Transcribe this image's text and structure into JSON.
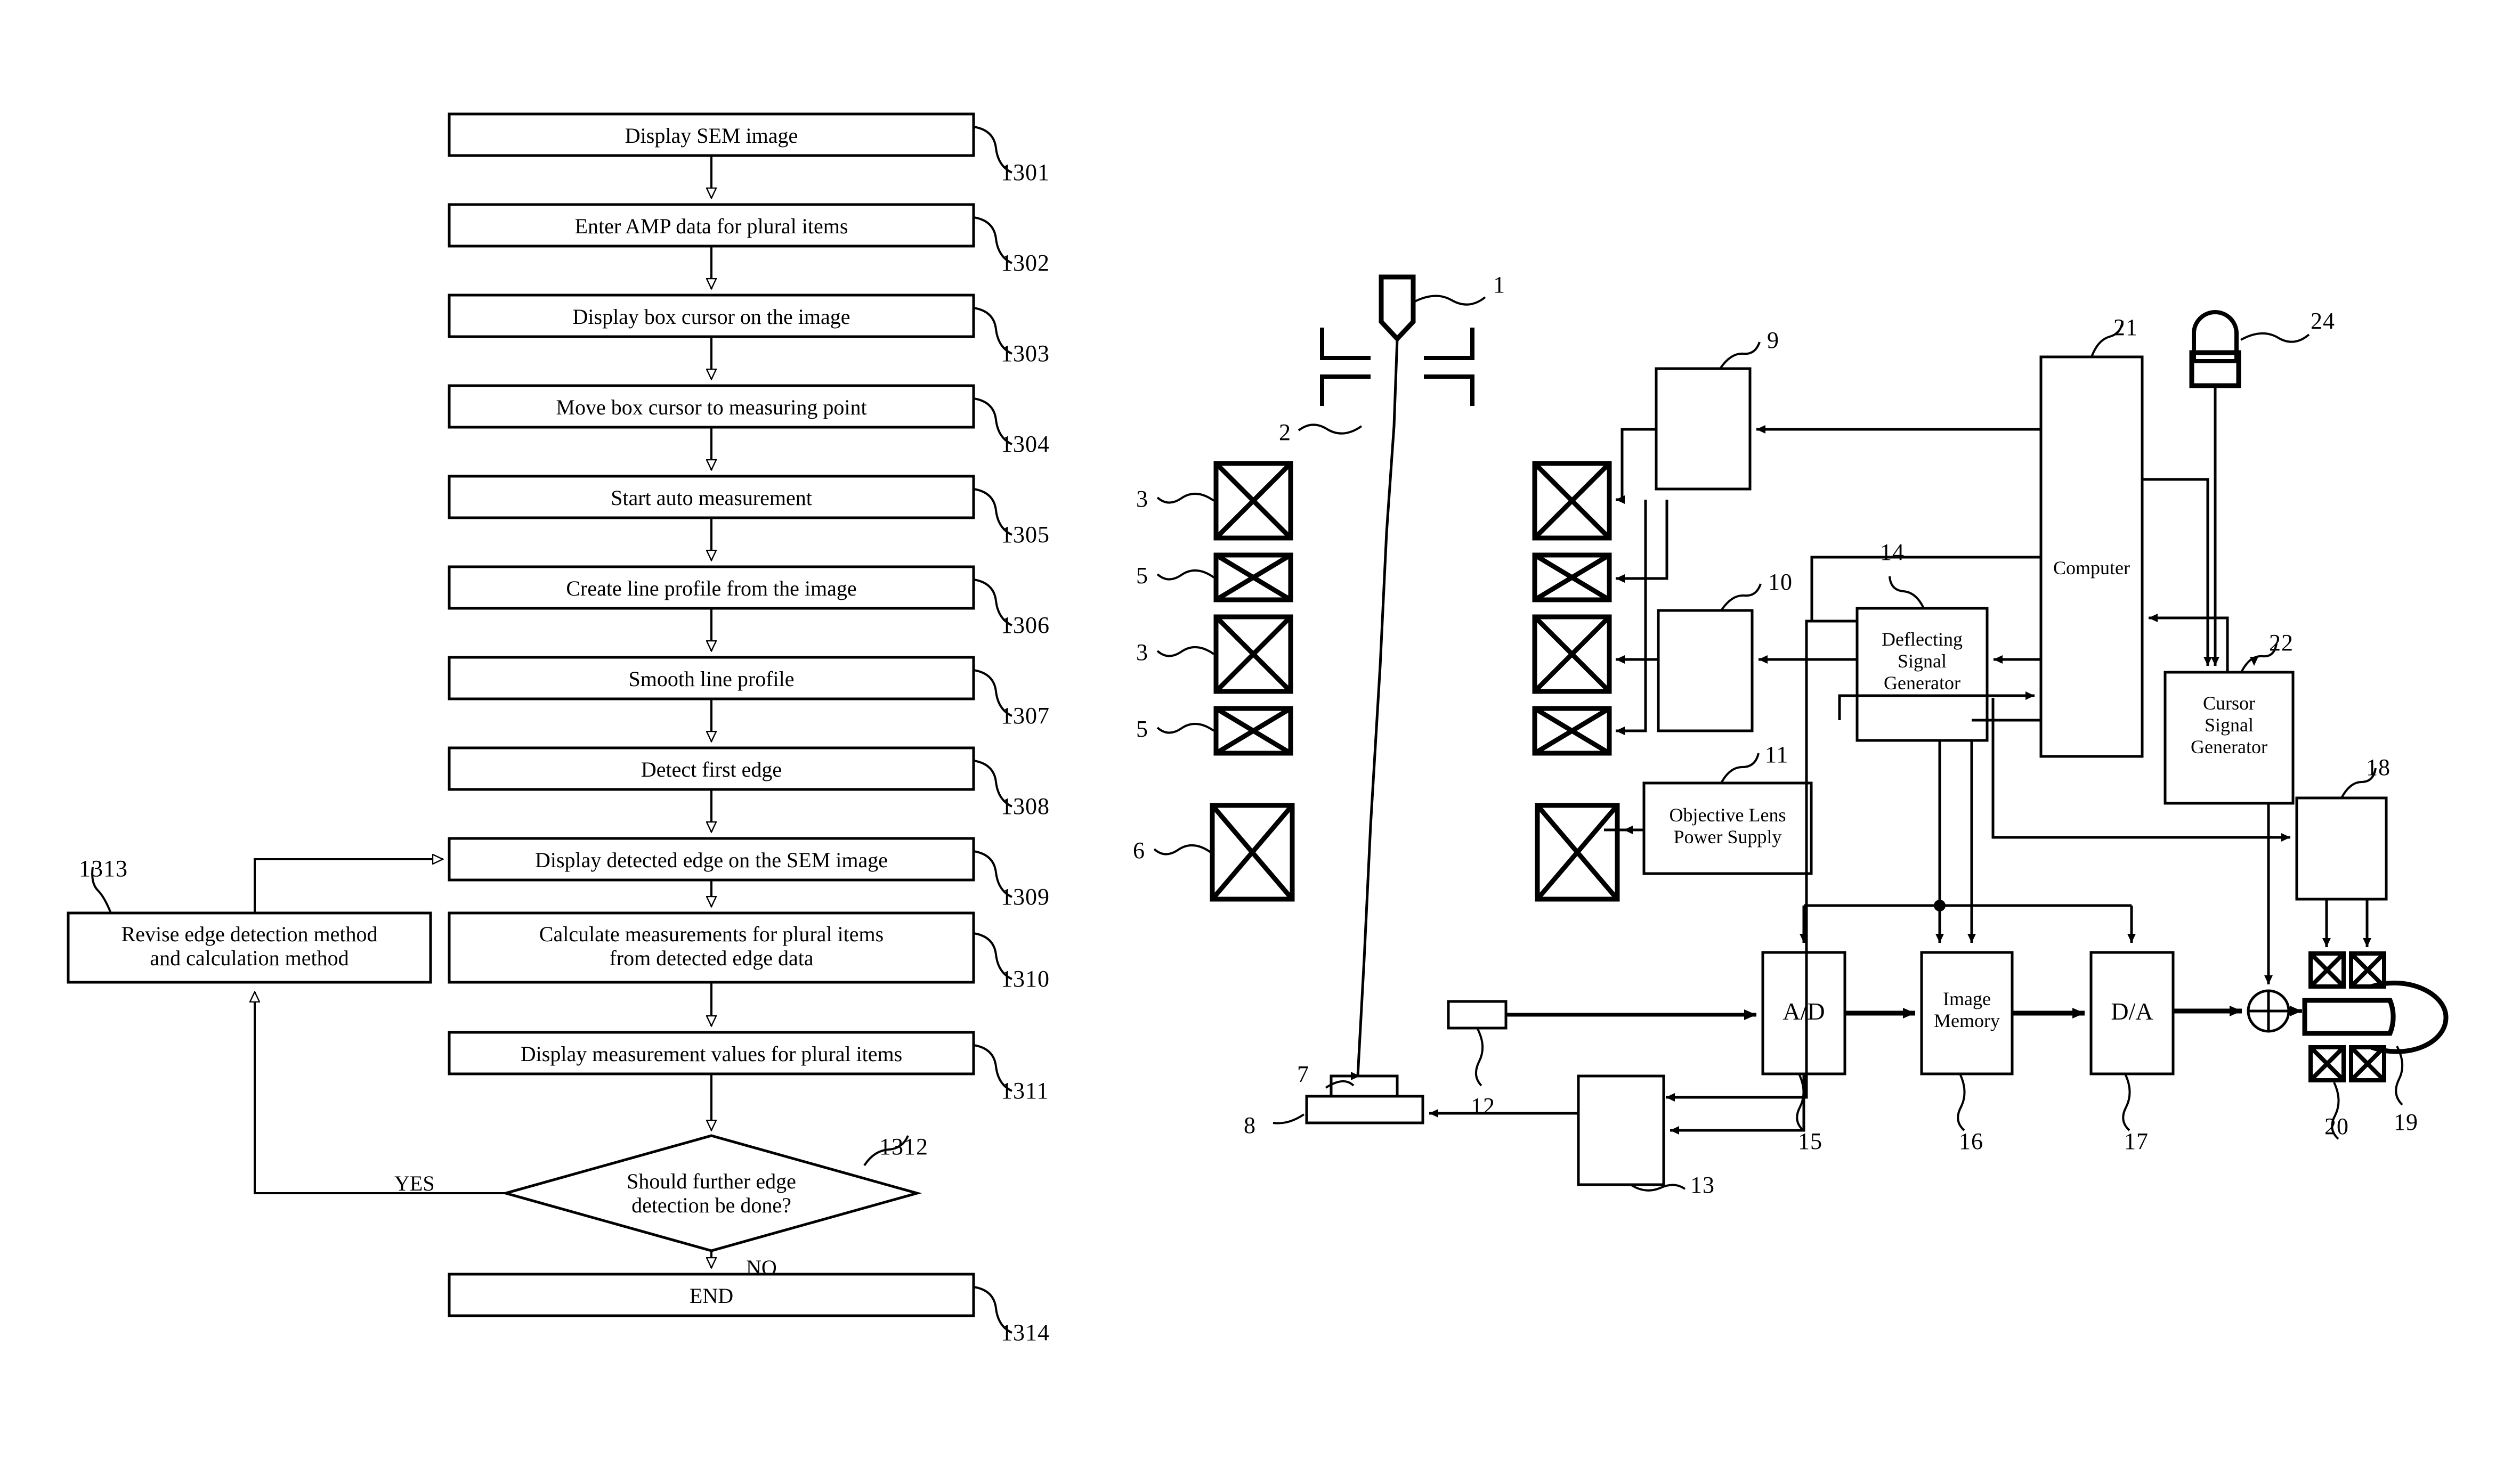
{
  "figure": {
    "kind": "patent-figure",
    "panels": [
      "flowchart",
      "sem-apparatus-block-diagram"
    ]
  },
  "flowchart": {
    "steps": [
      {
        "ref": "1301",
        "text": "Display SEM image"
      },
      {
        "ref": "1302",
        "text": "Enter AMP data for plural items"
      },
      {
        "ref": "1303",
        "text": "Display box cursor on the image"
      },
      {
        "ref": "1304",
        "text": "Move box cursor to measuring point"
      },
      {
        "ref": "1305",
        "text": "Start auto measurement"
      },
      {
        "ref": "1306",
        "text": "Create line profile from the image"
      },
      {
        "ref": "1307",
        "text": "Smooth line profile"
      },
      {
        "ref": "1308",
        "text": "Detect first edge"
      },
      {
        "ref": "1309",
        "text": "Display detected edge on the SEM image"
      },
      {
        "ref": "1310",
        "text": "Calculate measurements for plural items\nfrom detected edge data"
      },
      {
        "ref": "1311",
        "text": "Display measurement values for plural items"
      }
    ],
    "decision": {
      "ref": "1312",
      "text": "Should further edge\ndetection be done?"
    },
    "revise": {
      "ref": "1313",
      "text": "Revise edge detection method\nand calculation method"
    },
    "end": {
      "ref": "1314",
      "text": "END"
    },
    "branch_yes": "YES",
    "branch_no": "NO"
  },
  "apparatus": {
    "refs": {
      "gun": "1",
      "beam": "2",
      "lens_upper": "3",
      "lens_lower": "3b",
      "coil_upper": "5",
      "coil_lower": "5b",
      "objective_lens": "6",
      "specimen": "7",
      "stage": "8",
      "supply9": "9",
      "supply10": "10",
      "objective_supply": "11",
      "detector": "12",
      "stage_control": "13",
      "deflecting": "14",
      "ad": "15",
      "image_memory": "16",
      "da": "17",
      "crt_drive": "18",
      "crt": "19",
      "crt_coils": "20",
      "computer": "21",
      "cursor_gen": "22",
      "pointing_device": "24"
    },
    "labels": {
      "n1": "1",
      "n2": "2",
      "n3a": "3",
      "n3b": "3",
      "n5a": "5",
      "n5b": "5",
      "n6": "6",
      "n7": "7",
      "n8": "8",
      "n9": "9",
      "n10": "10",
      "n11": "11",
      "n12": "12",
      "n13": "13",
      "n14": "14",
      "n15": "15",
      "n16": "16",
      "n17": "17",
      "n18": "18",
      "n19": "19",
      "n20": "20",
      "n21": "21",
      "n22": "22",
      "n24": "24"
    },
    "blocks": {
      "computer": "Computer",
      "deflecting_signal_generator": "Deflecting\nSignal\nGenerator",
      "cursor_signal_generator": "Cursor\nSignal\nGenerator",
      "objective_lens_power_supply": "Objective Lens\nPower Supply",
      "ad": "A/D",
      "image_memory": "Image\nMemory",
      "da": "D/A"
    }
  },
  "colors": {
    "ink": "#000000",
    "paper": "#ffffff"
  }
}
